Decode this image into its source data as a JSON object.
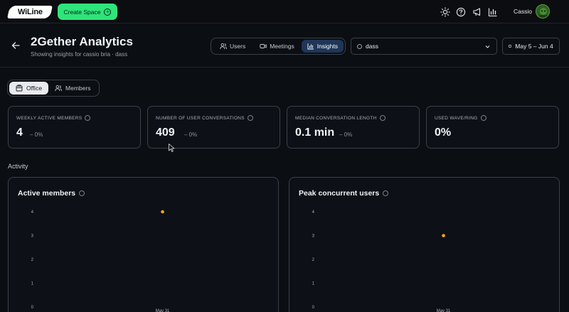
{
  "app": {
    "logo_text": "WiLine",
    "create_button": "Create Space",
    "user_name": "Cassio",
    "icons": [
      "sun-icon",
      "help-icon",
      "announcement-icon",
      "bar-chart-icon"
    ]
  },
  "header": {
    "title": "2Gether Analytics",
    "subtitle": "Showing insights for cassio bria · dass",
    "tabs": [
      {
        "label": "Users",
        "icon": "users-icon",
        "active": false
      },
      {
        "label": "Meetings",
        "icon": "video-icon",
        "active": false
      },
      {
        "label": "Insights",
        "icon": "bar-chart-icon",
        "active": true
      }
    ],
    "space_select": "dass",
    "date_range": "May 5 – Jun 4"
  },
  "view_toggle": [
    {
      "label": "Office",
      "icon": "office-icon",
      "active": true
    },
    {
      "label": "Members",
      "icon": "members-icon",
      "active": false
    }
  ],
  "metrics": [
    {
      "label": "Weekly active members",
      "value": "4",
      "delta": "– 0%"
    },
    {
      "label": "Number of user conversations",
      "value": "409",
      "delta": "– 0%"
    },
    {
      "label": "Median conversation length",
      "value": "0.1 min",
      "delta": "– 0%"
    },
    {
      "label": "Used wave/ring",
      "value": "0%",
      "delta": ""
    }
  ],
  "activity_label": "Activity",
  "chart_data": [
    {
      "type": "scatter",
      "title": "Active members",
      "x": [
        "May 31"
      ],
      "y": [
        4
      ],
      "yticks": [
        0,
        1,
        2,
        3,
        4
      ],
      "xtick_labels": [
        "May 31"
      ],
      "ylim": [
        0,
        4
      ],
      "grid": false,
      "color": "#f5a623"
    },
    {
      "type": "scatter",
      "title": "Peak concurrent users",
      "x": [
        "May 31"
      ],
      "y": [
        3
      ],
      "yticks": [
        0,
        1,
        2,
        3,
        4
      ],
      "xtick_labels": [
        "May 31"
      ],
      "ylim": [
        0,
        4
      ],
      "grid": false,
      "color": "#f5a623"
    }
  ]
}
